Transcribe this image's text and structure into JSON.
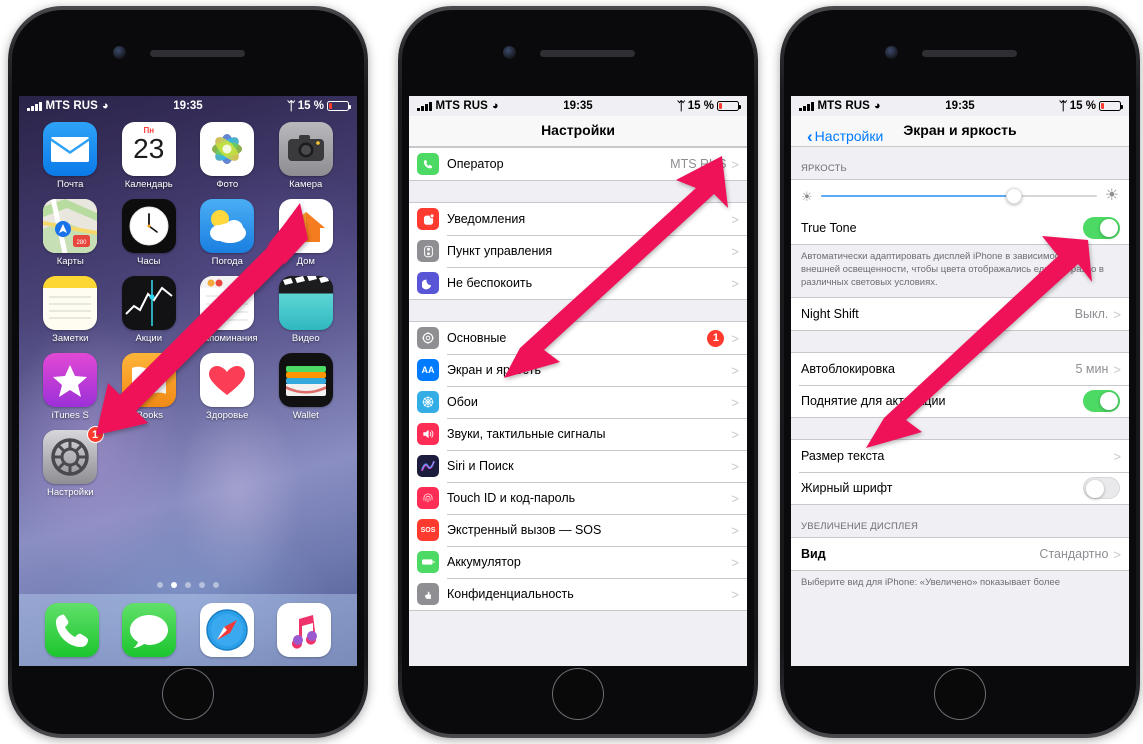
{
  "statusbar": {
    "carrier": "MTS RUS",
    "time": "19:35",
    "battery_percent": "15 %",
    "battery_level": 15,
    "signal_bars": 4,
    "wifi": true,
    "bluetooth": true
  },
  "phone1": {
    "name": "iphone-homescreen",
    "apps_row1": [
      {
        "label": "Почта",
        "icon": "mail-icon"
      },
      {
        "label": "Календарь",
        "icon": "calendar-icon",
        "weekday": "Пн",
        "day": "23"
      },
      {
        "label": "Фото",
        "icon": "photos-icon"
      },
      {
        "label": "Камера",
        "icon": "camera-icon"
      }
    ],
    "apps_row2": [
      {
        "label": "Карты",
        "icon": "maps-icon"
      },
      {
        "label": "Часы",
        "icon": "clock-icon"
      },
      {
        "label": "Погода",
        "icon": "weather-icon"
      },
      {
        "label": "Дом",
        "icon": "home-icon"
      }
    ],
    "apps_row3": [
      {
        "label": "Заметки",
        "icon": "notes-icon"
      },
      {
        "label": "Акции",
        "icon": "stocks-icon"
      },
      {
        "label": "Напоминания",
        "icon": "reminders-icon"
      },
      {
        "label": "Видео",
        "icon": "videos-icon"
      }
    ],
    "apps_row4": [
      {
        "label": "iTunes S",
        "icon": "itunes-store-icon"
      },
      {
        "label": "iBooks",
        "icon": "ibooks-icon"
      },
      {
        "label": "Здоровье",
        "icon": "health-icon"
      },
      {
        "label": "Wallet",
        "icon": "wallet-icon"
      }
    ],
    "apps_row5": [
      {
        "label": "Настройки",
        "icon": "settings-icon",
        "badge": "1"
      }
    ],
    "dock": [
      {
        "label": "Телефон",
        "icon": "phone-icon"
      },
      {
        "label": "Сообщения",
        "icon": "messages-icon"
      },
      {
        "label": "Safari",
        "icon": "safari-icon"
      },
      {
        "label": "Музыка",
        "icon": "music-icon"
      }
    ],
    "page_dots": {
      "count": 5,
      "active_index": 1
    }
  },
  "phone2": {
    "name": "settings-list",
    "title": "Настройки",
    "group1": [
      {
        "label": "Оператор",
        "value": "MTS RUS",
        "icon": "phone-green-icon",
        "chevron": ">"
      }
    ],
    "group2": [
      {
        "label": "Уведомления",
        "icon": "notifications-icon",
        "chevron": ">"
      },
      {
        "label": "Пункт управления",
        "icon": "control-center-icon",
        "chevron": ">"
      },
      {
        "label": "Не беспокоить",
        "icon": "do-not-disturb-icon",
        "chevron": ">"
      }
    ],
    "group3": [
      {
        "label": "Основные",
        "icon": "general-gear-icon",
        "badge": "1",
        "chevron": ">"
      },
      {
        "label": "Экран и яркость",
        "icon": "display-brightness-icon",
        "chevron": ">"
      },
      {
        "label": "Обои",
        "icon": "wallpaper-icon",
        "chevron": ">"
      },
      {
        "label": "Звуки, тактильные сигналы",
        "icon": "sounds-icon",
        "chevron": ">"
      },
      {
        "label": "Siri и Поиск",
        "icon": "siri-icon",
        "chevron": ">"
      },
      {
        "label": "Touch ID и код-пароль",
        "icon": "touch-id-icon",
        "chevron": ">"
      },
      {
        "label": "Экстренный вызов — SOS",
        "icon": "sos-icon",
        "chevron": ">"
      },
      {
        "label": "Аккумулятор",
        "icon": "battery-icon",
        "chevron": ">"
      },
      {
        "label": "Конфиденциальность",
        "icon": "privacy-icon",
        "chevron": ">"
      }
    ]
  },
  "phone3": {
    "name": "display-and-brightness",
    "back_label": "Настройки",
    "title": "Экран и яркость",
    "brightness_header": "ЯРКОСТЬ",
    "brightness_value": 70,
    "true_tone": {
      "label": "True Tone",
      "state": "on"
    },
    "true_tone_footer": "Автоматически адаптировать дисплей iPhone в зависимости от внешней освещенности, чтобы цвета отображались единообразно в различных световых условиях.",
    "night_shift": {
      "label": "Night Shift",
      "value": "Выкл.",
      "chevron": ">"
    },
    "autolock": {
      "label": "Автоблокировка",
      "value": "5 мин",
      "chevron": ">"
    },
    "raise_to_wake": {
      "label": "Поднятие для активации",
      "state": "on"
    },
    "text_size": {
      "label": "Размер текста",
      "chevron": ">"
    },
    "bold_text": {
      "label": "Жирный шрифт",
      "state": "off"
    },
    "zoom_header": "УВЕЛИЧЕНИЕ ДИСПЛЕЯ",
    "view": {
      "label": "Вид",
      "value": "Стандартно",
      "chevron": ">"
    },
    "view_footer": "Выберите вид для iPhone: «Увеличено» показывает более"
  },
  "annotations": {
    "arrow_color": "#ef1259",
    "arrows": [
      {
        "name": "arrow-to-settings-app",
        "from": "dom-app",
        "to": "settings-app-icon"
      },
      {
        "name": "arrow-to-display-brightness-row",
        "from": "operator-row",
        "to": "display-brightness-row"
      },
      {
        "name": "arrow-to-true-tone-toggle",
        "from": "raise-to-wake-row",
        "to": "true-tone-toggle"
      }
    ]
  }
}
